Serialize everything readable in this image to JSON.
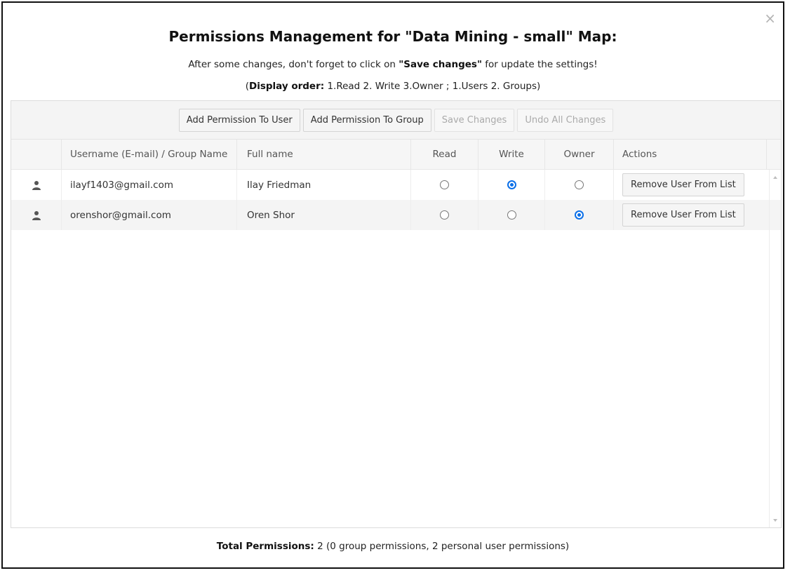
{
  "dialog": {
    "title": "Permissions Management for \"Data Mining - small\" Map:",
    "subtitle_prefix": "After some changes, don't forget to click on ",
    "subtitle_bold": "\"Save changes\"",
    "subtitle_suffix": " for update the settings!",
    "order_open": "(",
    "order_label": "Display order:",
    "order_text": " 1.Read 2. Write 3.Owner ; 1.Users 2. Groups)",
    "close_glyph": "×"
  },
  "toolbar": {
    "add_user": "Add Permission To User",
    "add_group": "Add Permission To Group",
    "save": "Save Changes",
    "undo": "Undo All Changes"
  },
  "columns": {
    "username": "Username (E-mail) / Group Name",
    "fullname": "Full name",
    "read": "Read",
    "write": "Write",
    "owner": "Owner",
    "actions": "Actions"
  },
  "rows": [
    {
      "email": "ilayf1403@gmail.com",
      "name": "Ilay Friedman",
      "permission": "write",
      "action": "Remove User From List"
    },
    {
      "email": "orenshor@gmail.com",
      "name": "Oren Shor",
      "permission": "owner",
      "action": "Remove User From List"
    }
  ],
  "footer": {
    "label": "Total Permissions:",
    "text": " 2 (0 group permissions, 2 personal user permissions)"
  },
  "colors": {
    "accent": "#0b6fe8"
  }
}
